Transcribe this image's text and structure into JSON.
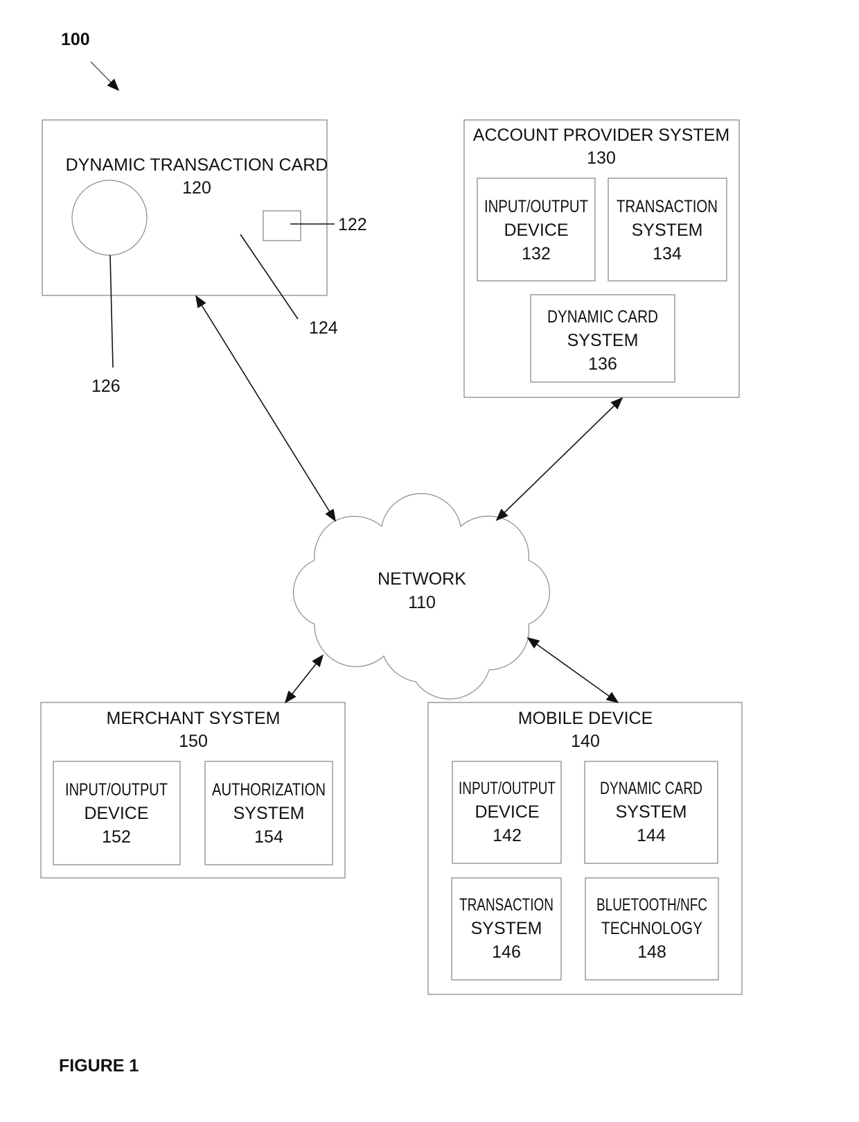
{
  "figure": {
    "system_ref": "100",
    "caption": "FIGURE 1"
  },
  "card": {
    "title": "DYNAMIC TRANSACTION CARD",
    "ref": "120",
    "chip_ref": "122",
    "body_ref": "124",
    "display_ref": "126"
  },
  "network": {
    "title": "NETWORK",
    "ref": "110"
  },
  "account_provider": {
    "title": "ACCOUNT PROVIDER SYSTEM",
    "ref": "130",
    "components": [
      {
        "line1": "INPUT/OUTPUT",
        "line2": "DEVICE",
        "ref": "132"
      },
      {
        "line1": "TRANSACTION",
        "line2": "SYSTEM",
        "ref": "134"
      },
      {
        "line1": "DYNAMIC CARD",
        "line2": "SYSTEM",
        "ref": "136"
      }
    ]
  },
  "merchant": {
    "title": "MERCHANT SYSTEM",
    "ref": "150",
    "components": [
      {
        "line1": "INPUT/OUTPUT",
        "line2": "DEVICE",
        "ref": "152"
      },
      {
        "line1": "AUTHORIZATION",
        "line2": "SYSTEM",
        "ref": "154"
      }
    ]
  },
  "mobile": {
    "title": "MOBILE DEVICE",
    "ref": "140",
    "components": [
      {
        "line1": "INPUT/OUTPUT",
        "line2": "DEVICE",
        "ref": "142"
      },
      {
        "line1": "DYNAMIC CARD",
        "line2": "SYSTEM",
        "ref": "144"
      },
      {
        "line1": "TRANSACTION",
        "line2": "SYSTEM",
        "ref": "146"
      },
      {
        "line1": "BLUETOOTH/NFC",
        "line2": "TECHNOLOGY",
        "ref": "148"
      }
    ]
  },
  "connections": [
    {
      "from": "card",
      "to": "network",
      "type": "bidirectional"
    },
    {
      "from": "account_provider",
      "to": "network",
      "type": "bidirectional"
    },
    {
      "from": "merchant",
      "to": "network",
      "type": "bidirectional"
    },
    {
      "from": "mobile",
      "to": "network",
      "type": "bidirectional"
    }
  ]
}
